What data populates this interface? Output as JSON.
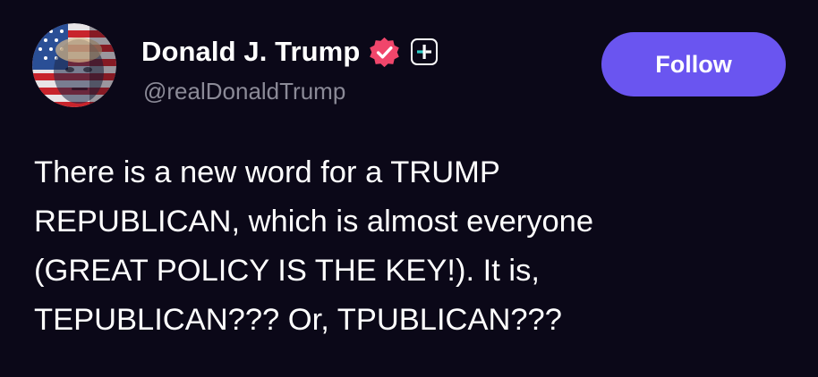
{
  "profile": {
    "display_name": "Donald J. Trump",
    "handle": "@realDonaldTrump",
    "avatar_icon": "flag-face-avatar",
    "verified_icon": "verified-badge-icon",
    "plus_icon": "plus-badge-icon"
  },
  "actions": {
    "follow_label": "Follow"
  },
  "post": {
    "lines": [
      "There is a new word for a TRUMP",
      "REPUBLICAN, which is almost everyone",
      "(GREAT POLICY IS THE KEY!). It is,",
      "TEPUBLICAN??? Or, TPUBLICAN???"
    ]
  },
  "colors": {
    "background": "#0b0818",
    "accent": "#6a55f0",
    "verified": "#f0466b",
    "handle_text": "#8b8a97"
  }
}
